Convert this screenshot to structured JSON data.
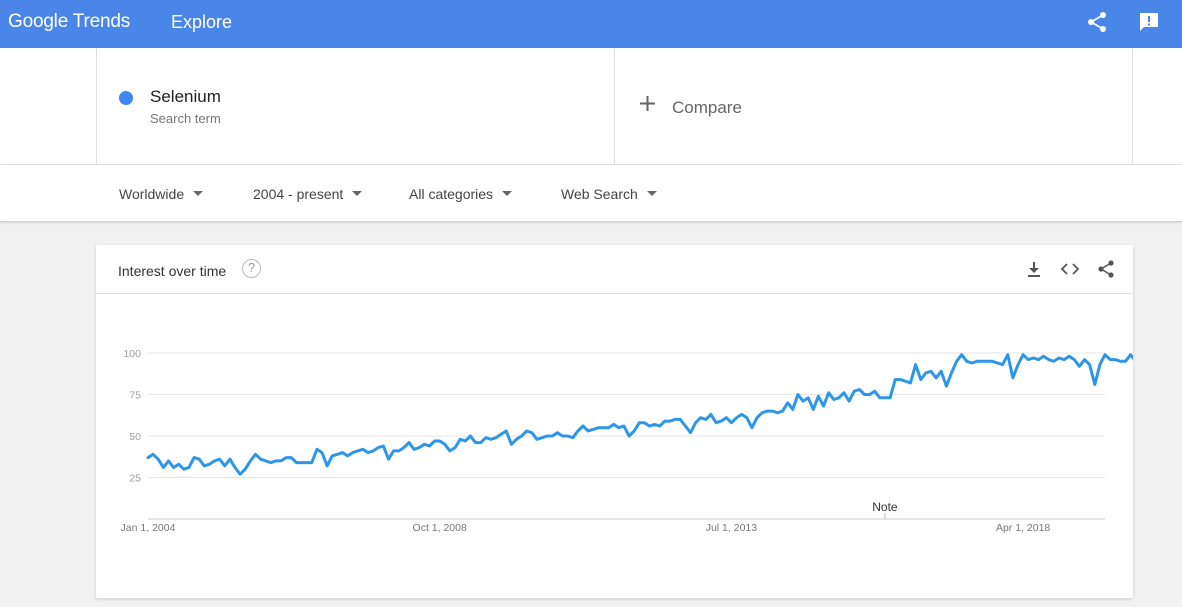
{
  "app": {
    "logo": "Google Trends",
    "page": "Explore"
  },
  "header_icons": [
    "share-icon",
    "feedback-icon"
  ],
  "search_term": {
    "name": "Selenium",
    "subtitle": "Search term",
    "color": "#4285f4"
  },
  "compare": {
    "label": "Compare"
  },
  "filters": {
    "region": "Worldwide",
    "time": "2004 - present",
    "category": "All categories",
    "property": "Web Search"
  },
  "panel": {
    "title": "Interest over time",
    "help": "?",
    "icons": [
      "download-icon",
      "embed-icon",
      "share-icon"
    ]
  },
  "chart_data": {
    "type": "line",
    "title": "",
    "xlabel": "",
    "ylabel": "",
    "grid": true,
    "legend": "none",
    "y_ticks": [
      25,
      50,
      75,
      100
    ],
    "ylim": [
      0,
      100
    ],
    "xlim": [
      "2004-01",
      "2019-08"
    ],
    "x_ticks": [
      {
        "date": "2004-01",
        "label": "Jan 1, 2004"
      },
      {
        "date": "2008-10",
        "label": "Oct 1, 2008"
      },
      {
        "date": "2013-07",
        "label": "Jul 1, 2013"
      },
      {
        "date": "2018-04",
        "label": "Apr 1, 2018"
      }
    ],
    "annotations": [
      {
        "date": "2016-01",
        "label": "Note"
      }
    ],
    "series": [
      {
        "color": "#2d96e8",
        "start": "2004-01",
        "interval": "month",
        "values": [
          37,
          39,
          36,
          31,
          35,
          31,
          33,
          30,
          31,
          37,
          36,
          32,
          33,
          35,
          36,
          32,
          36,
          31,
          27,
          30,
          35,
          39,
          36,
          35,
          34,
          35,
          35,
          37,
          37,
          34,
          34,
          34,
          34,
          42,
          40,
          32,
          38,
          39,
          40,
          38,
          40,
          41,
          42,
          40,
          41,
          43,
          44,
          36,
          41,
          41,
          43,
          46,
          42,
          43,
          45,
          44,
          47,
          47,
          45,
          41,
          43,
          48,
          47,
          50,
          46,
          46,
          49,
          48,
          49,
          51,
          53,
          45,
          48,
          50,
          53,
          52,
          48,
          49,
          50,
          50,
          52,
          50,
          50,
          49,
          53,
          56,
          53,
          54,
          55,
          55,
          55,
          57,
          55,
          56,
          50,
          53,
          58,
          58,
          56,
          57,
          56,
          59,
          59,
          60,
          60,
          56,
          52,
          58,
          61,
          60,
          63,
          58,
          59,
          61,
          58,
          61,
          63,
          61,
          55,
          61,
          64,
          65,
          65,
          64,
          65,
          70,
          66,
          75,
          71,
          73,
          66,
          74,
          68,
          76,
          72,
          73,
          76,
          71,
          77,
          78,
          75,
          75,
          77,
          73,
          73,
          73,
          84,
          84,
          83,
          82,
          93,
          84,
          88,
          89,
          85,
          89,
          80,
          88,
          95,
          99,
          95,
          94,
          95,
          95,
          95,
          95,
          94,
          93,
          99,
          85,
          93,
          99,
          96,
          97,
          96,
          98,
          96,
          95,
          97,
          96,
          98,
          96,
          92,
          96,
          93,
          81,
          93,
          99,
          96,
          96,
          95,
          95,
          99,
          95,
          95,
          89,
          94,
          89
        ]
      }
    ]
  }
}
